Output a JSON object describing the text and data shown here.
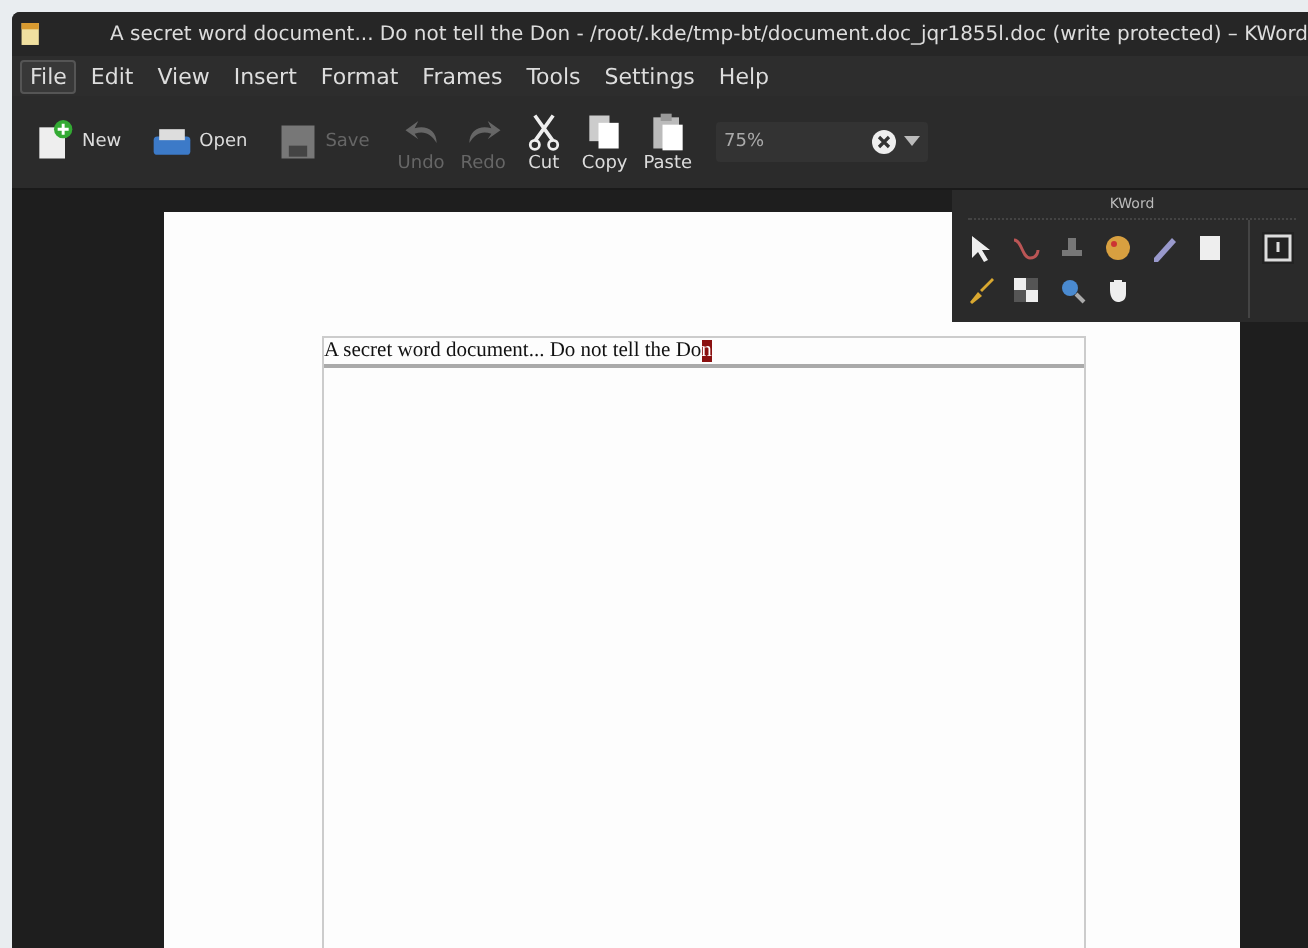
{
  "window": {
    "title": "A secret word document... Do not tell the Don - /root/.kde/tmp-bt/document.doc_jqr1855l.doc (write protected) – KWord"
  },
  "menu": [
    {
      "label": "File",
      "selected": true
    },
    {
      "label": "Edit",
      "selected": false
    },
    {
      "label": "View",
      "selected": false
    },
    {
      "label": "Insert",
      "selected": false
    },
    {
      "label": "Format",
      "selected": false
    },
    {
      "label": "Frames",
      "selected": false
    },
    {
      "label": "Tools",
      "selected": false
    },
    {
      "label": "Settings",
      "selected": false
    },
    {
      "label": "Help",
      "selected": false
    }
  ],
  "toolbar": [
    {
      "kind": "new",
      "label": "New",
      "disabled": false
    },
    {
      "kind": "open",
      "label": "Open",
      "disabled": false
    },
    {
      "kind": "save",
      "label": "Save",
      "disabled": true
    },
    {
      "kind": "undo",
      "label": "Undo",
      "disabled": true
    },
    {
      "kind": "redo",
      "label": "Redo",
      "disabled": true
    },
    {
      "kind": "cut",
      "label": "Cut",
      "disabled": false
    },
    {
      "kind": "copy",
      "label": "Copy",
      "disabled": false
    },
    {
      "kind": "paste",
      "label": "Paste",
      "disabled": false
    }
  ],
  "zoom": {
    "value": "75%"
  },
  "toolbox": {
    "title": "KWord"
  },
  "document": {
    "text": "A secret word document... Do not tell the Do",
    "selected_text": "n"
  }
}
